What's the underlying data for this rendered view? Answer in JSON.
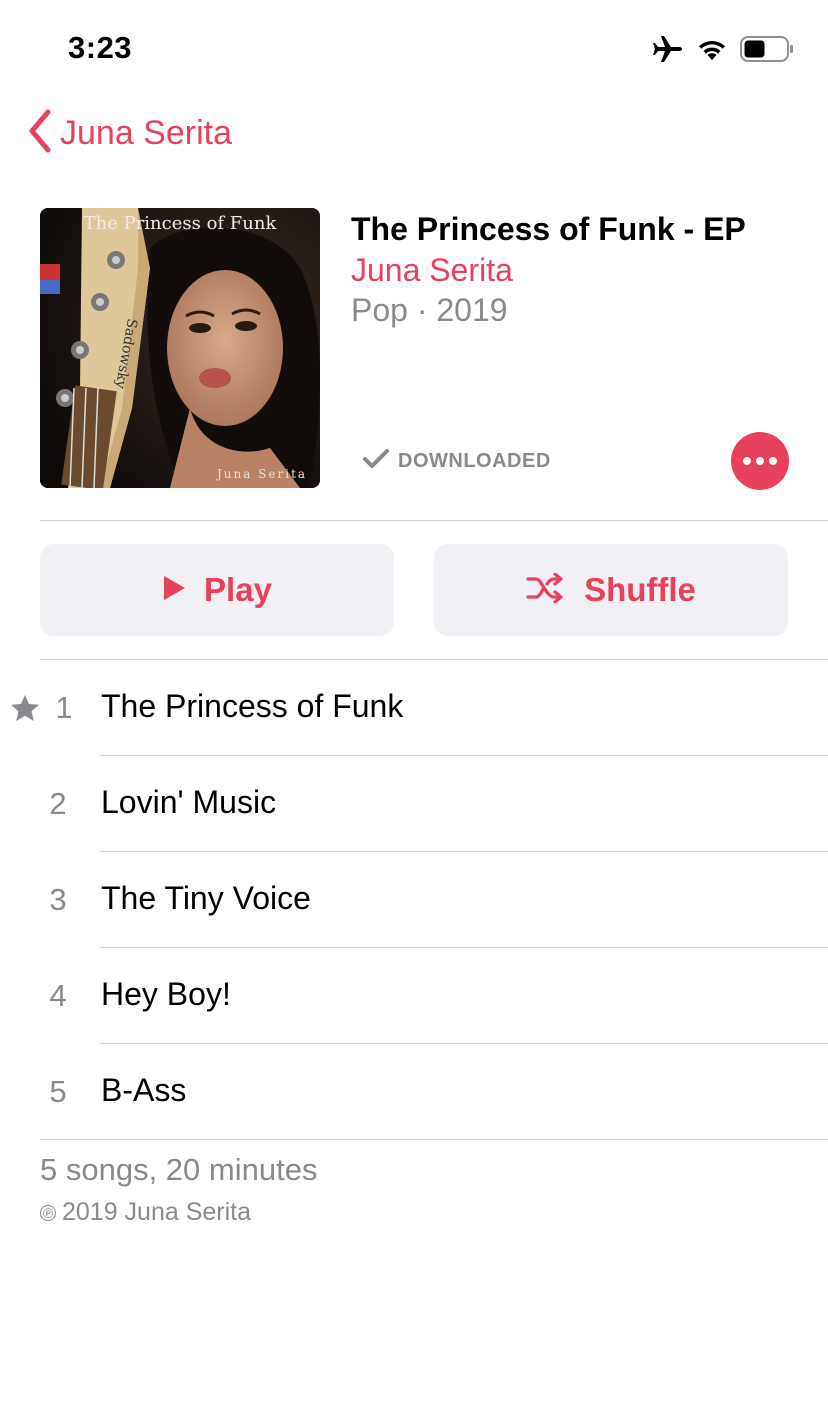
{
  "status_bar": {
    "time": "3:23",
    "icons": [
      "airplane-icon",
      "wifi-icon",
      "battery-icon"
    ]
  },
  "nav": {
    "back_label": "Juna Serita"
  },
  "album": {
    "cover_text_top": "The Princess of Funk",
    "cover_text_bottom": "Juna Serita",
    "cover_text_bass": "Sadowsky",
    "title": "The Princess of Funk - EP",
    "artist": "Juna Serita",
    "meta": "Pop · 2019",
    "download_status": "DOWNLOADED"
  },
  "actions": {
    "play_label": "Play",
    "shuffle_label": "Shuffle"
  },
  "tracks": [
    {
      "number": "1",
      "title": "The Princess of Funk",
      "starred": true
    },
    {
      "number": "2",
      "title": "Lovin' Music",
      "starred": false
    },
    {
      "number": "3",
      "title": "The Tiny Voice",
      "starred": false
    },
    {
      "number": "4",
      "title": "Hey Boy!",
      "starred": false
    },
    {
      "number": "5",
      "title": "B-Ass",
      "starred": false
    }
  ],
  "footer": {
    "summary": "5 songs, 20 minutes",
    "copyright_symbol": "℗",
    "copyright": "2019 Juna Serita"
  },
  "colors": {
    "accent": "#e8415b",
    "secondary_text": "#8a8a8e",
    "button_bg": "#f0f0f5",
    "divider": "#d1d1d6"
  }
}
